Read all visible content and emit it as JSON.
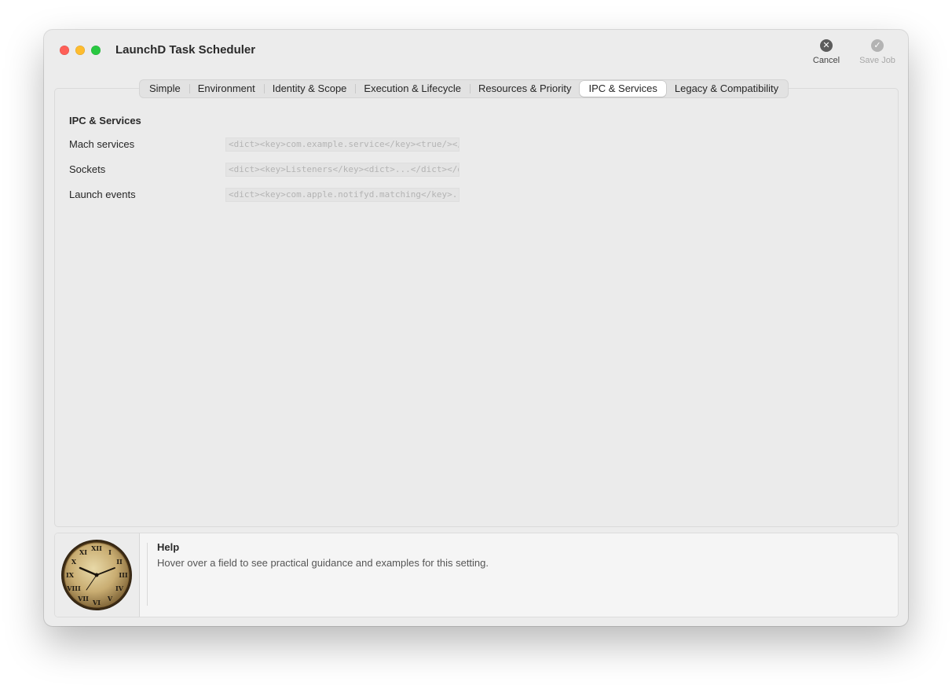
{
  "window": {
    "title": "LaunchD Task Scheduler"
  },
  "toolbar": {
    "cancel_label": "Cancel",
    "save_label": "Save Job"
  },
  "tabs": [
    {
      "label": "Simple"
    },
    {
      "label": "Environment"
    },
    {
      "label": "Identity & Scope"
    },
    {
      "label": "Execution & Lifecycle"
    },
    {
      "label": "Resources & Priority"
    },
    {
      "label": "IPC & Services"
    },
    {
      "label": "Legacy & Compatibility"
    }
  ],
  "active_tab": "IPC & Services",
  "section": {
    "title": "IPC & Services",
    "rows": [
      {
        "label": "Mach services",
        "placeholder": "<dict><key>com.example.service</key><true/></dict>"
      },
      {
        "label": "Sockets",
        "placeholder": "<dict><key>Listeners</key><dict>...</dict></dict>"
      },
      {
        "label": "Launch events",
        "placeholder": "<dict><key>com.apple.notifyd.matching</key>...</dict>"
      }
    ]
  },
  "help": {
    "title": "Help",
    "text": "Hover over a field to see practical guidance and examples for this setting.",
    "image_icon": "clock-icon"
  },
  "colors": {
    "close": "#fe5f57",
    "minimize": "#febc2e",
    "zoom": "#28c840",
    "window_bg": "#ececec"
  }
}
